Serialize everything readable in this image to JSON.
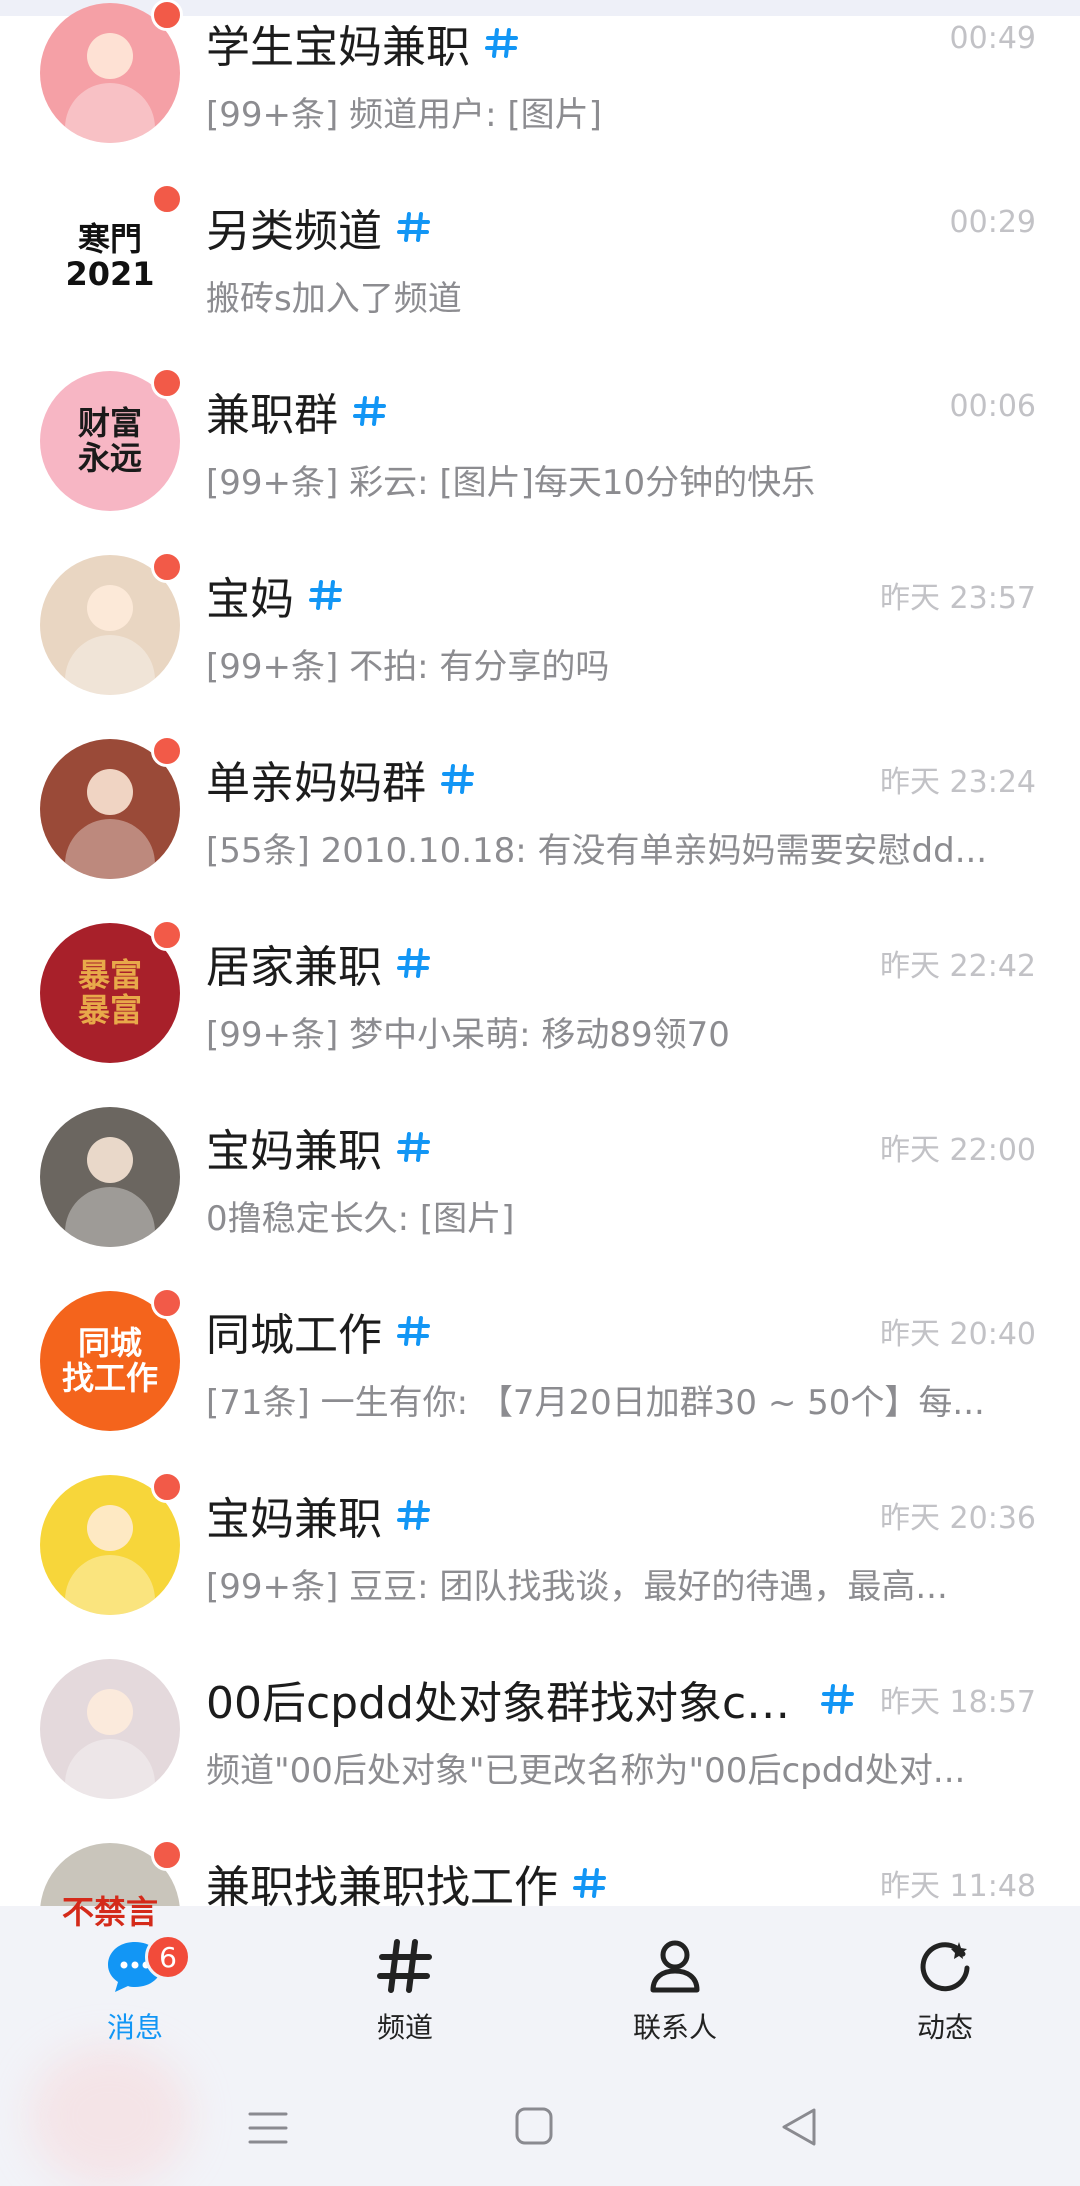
{
  "colors": {
    "accent": "#1296f5",
    "unread_dot": "#f25a48",
    "badge": "#f24b3a",
    "time": "#c2c2c6",
    "preview": "#8c8c90"
  },
  "channels": [
    {
      "name": "学生宝妈兼职",
      "time": "00:49",
      "preview": "[99+条] 频道用户: [图片]",
      "avatar_bg": "#f5a0a6",
      "avatar_text": "",
      "unread": true
    },
    {
      "name": "另类频道",
      "time": "00:29",
      "preview": "搬砖s加入了频道",
      "avatar_bg": "#ffffff",
      "avatar_text": "寒門\n2021",
      "avatar_fg": "#111111",
      "unread": true
    },
    {
      "name": "兼职群",
      "time": "00:06",
      "preview": "[99+条] 彩云: [图片]每天10分钟的快乐",
      "avatar_bg": "#f7b6c4",
      "avatar_text": "财富\n永远",
      "avatar_fg": "#1a1a1a",
      "unread": true
    },
    {
      "name": "宝妈",
      "time": "昨天 23:57",
      "preview": "[99+条] 不拍: 有分享的吗",
      "avatar_bg": "#e9d6c2",
      "avatar_text": "",
      "unread": true
    },
    {
      "name": "单亲妈妈群",
      "time": "昨天 23:24",
      "preview": "[55条] 2010.10.18: 有没有单亲妈妈需要安慰dd...",
      "avatar_bg": "#9a4a38",
      "avatar_text": "",
      "unread": true
    },
    {
      "name": "居家兼职",
      "time": "昨天 22:42",
      "preview": "[99+条] 梦中小呆萌: 移动89领70",
      "avatar_bg": "#a8202a",
      "avatar_text": "暴富\n暴富",
      "avatar_fg": "#e8a94a",
      "unread": true
    },
    {
      "name": "宝妈兼职",
      "time": "昨天 22:00",
      "preview": "0撸稳定长久: [图片]",
      "avatar_bg": "#6b6660",
      "avatar_text": "",
      "unread": false
    },
    {
      "name": "同城工作",
      "time": "昨天 20:40",
      "preview": "[71条] 一生有你: 【7月20日加群30 ~ 50个】每...",
      "avatar_bg": "#f4641c",
      "avatar_text": "同城\n找工作",
      "avatar_fg": "#ffffff",
      "unread": true
    },
    {
      "name": "宝妈兼职",
      "time": "昨天 20:36",
      "preview": "[99+条] 豆豆: 团队找我谈，最好的待遇，最高...",
      "avatar_bg": "#f7d63a",
      "avatar_text": "",
      "unread": true
    },
    {
      "name": "00后cpdd处对象群找对象cp...",
      "time": "昨天 18:57",
      "preview": "频道\"00后处对象\"已更改名称为\"00后cpdd处对...",
      "avatar_bg": "#e4d9dc",
      "avatar_text": "",
      "unread": false
    },
    {
      "name": "兼职找兼职找工作",
      "time": "昨天 11:48",
      "preview": "",
      "avatar_bg": "#c9c5bb",
      "avatar_text": "不禁言",
      "avatar_fg": "#d42a1a",
      "unread": true
    }
  ],
  "tabs": [
    {
      "label": "消息",
      "icon": "chat-bubble-icon",
      "active": true,
      "badge": "6"
    },
    {
      "label": "频道",
      "icon": "hashtag-icon",
      "active": false
    },
    {
      "label": "联系人",
      "icon": "person-icon",
      "active": false
    },
    {
      "label": "动态",
      "icon": "refresh-star-icon",
      "active": false
    }
  ],
  "system_nav": [
    "menu-icon",
    "home-icon",
    "back-icon"
  ]
}
